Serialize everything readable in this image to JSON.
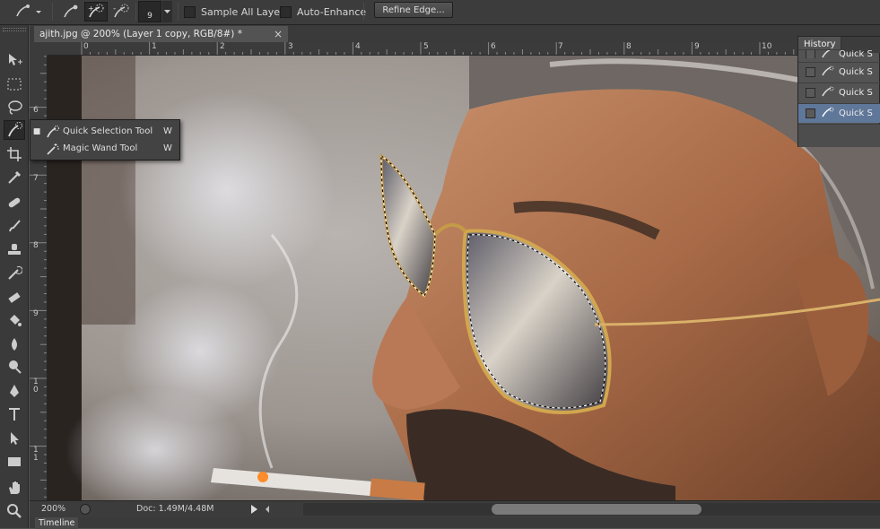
{
  "options_bar": {
    "brush_size": "9",
    "sample_all_layers": "Sample All Layers",
    "auto_enhance": "Auto-Enhance",
    "refine_edge": "Refine Edge..."
  },
  "document": {
    "tab_title": "ajith.jpg @ 200% (Layer 1 copy, RGB/8#) *",
    "close": "×"
  },
  "rulers": {
    "horizontal": [
      "0",
      "1",
      "2",
      "3",
      "4",
      "5",
      "6",
      "7",
      "8",
      "9",
      "10"
    ],
    "vertical": [
      "6",
      "7",
      "8",
      "9",
      "10",
      "11"
    ]
  },
  "tool_flyout": {
    "items": [
      {
        "label": "Quick Selection Tool",
        "shortcut": "W",
        "selected": true
      },
      {
        "label": "Magic Wand Tool",
        "shortcut": "W",
        "selected": false
      }
    ]
  },
  "history": {
    "tab": "History",
    "rows": [
      "Quick S",
      "Quick S",
      "Quick S",
      "Quick S"
    ]
  },
  "status": {
    "zoom": "200%",
    "doc": "Doc: 1.49M/4.48M"
  },
  "timeline": {
    "tab": "Timeline"
  }
}
